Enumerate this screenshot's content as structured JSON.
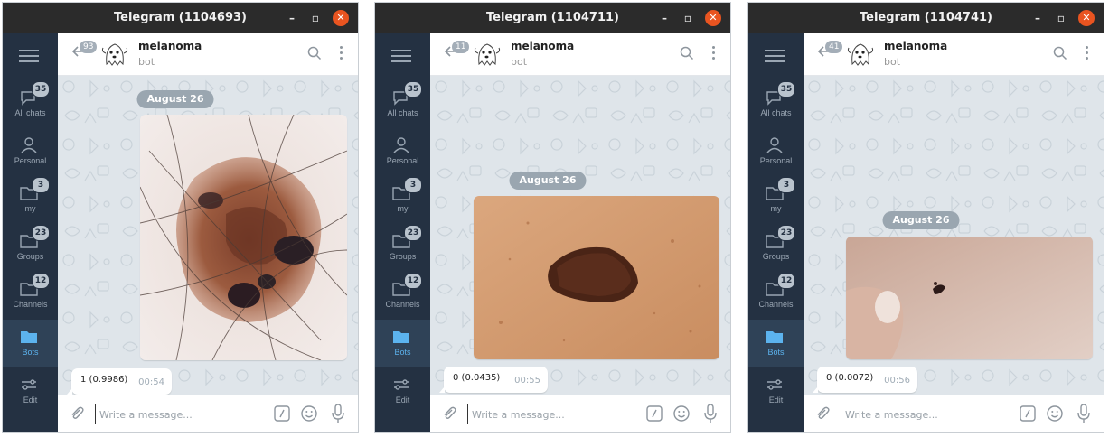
{
  "windows": [
    {
      "title": "Telegram (1104693)",
      "sidebar": [
        {
          "label": "All chats",
          "badge": "35",
          "icon": "chats-icon"
        },
        {
          "label": "Personal",
          "badge": "",
          "icon": "person-icon"
        },
        {
          "label": "my",
          "badge": "3",
          "icon": "folder-icon"
        },
        {
          "label": "Groups",
          "badge": "23",
          "icon": "folder-icon"
        },
        {
          "label": "Channels",
          "badge": "12",
          "icon": "folder-icon"
        },
        {
          "label": "Bots",
          "badge": "",
          "icon": "folder-filled-icon",
          "active": true
        },
        {
          "label": "Edit",
          "badge": "",
          "icon": "sliders-icon"
        }
      ],
      "chat": {
        "name": "melanoma",
        "status": "bot",
        "unread": "93"
      },
      "date": "August 26",
      "message": {
        "text": "1 (0.9986)",
        "time": "00:54"
      },
      "composer": {
        "placeholder": "Write a message..."
      }
    },
    {
      "title": "Telegram (1104711)",
      "sidebar": [
        {
          "label": "All chats",
          "badge": "35",
          "icon": "chats-icon"
        },
        {
          "label": "Personal",
          "badge": "",
          "icon": "person-icon"
        },
        {
          "label": "my",
          "badge": "3",
          "icon": "folder-icon"
        },
        {
          "label": "Groups",
          "badge": "23",
          "icon": "folder-icon"
        },
        {
          "label": "Channels",
          "badge": "12",
          "icon": "folder-icon"
        },
        {
          "label": "Bots",
          "badge": "",
          "icon": "folder-filled-icon",
          "active": true
        },
        {
          "label": "Edit",
          "badge": "",
          "icon": "sliders-icon"
        }
      ],
      "chat": {
        "name": "melanoma",
        "status": "bot",
        "unread": "11"
      },
      "date": "August 26",
      "message": {
        "text": "0 (0.0435)",
        "time": "00:55"
      },
      "composer": {
        "placeholder": "Write a message..."
      }
    },
    {
      "title": "Telegram (1104741)",
      "sidebar": [
        {
          "label": "All chats",
          "badge": "35",
          "icon": "chats-icon"
        },
        {
          "label": "Personal",
          "badge": "",
          "icon": "person-icon"
        },
        {
          "label": "my",
          "badge": "3",
          "icon": "folder-icon"
        },
        {
          "label": "Groups",
          "badge": "23",
          "icon": "folder-icon"
        },
        {
          "label": "Channels",
          "badge": "12",
          "icon": "folder-icon"
        },
        {
          "label": "Bots",
          "badge": "",
          "icon": "folder-filled-icon",
          "active": true
        },
        {
          "label": "Edit",
          "badge": "",
          "icon": "sliders-icon"
        }
      ],
      "chat": {
        "name": "melanoma",
        "status": "bot",
        "unread": "41"
      },
      "date": "August 26",
      "message": {
        "text": "0 (0.0072)",
        "time": "00:56"
      },
      "composer": {
        "placeholder": "Write a message..."
      }
    }
  ],
  "colors": {
    "titlebar": "#2b2b2b",
    "sidebar": "#243142",
    "active_folder": "#5cb3ee",
    "close_button": "#e95420",
    "chat_background": "#dfe5ea"
  }
}
